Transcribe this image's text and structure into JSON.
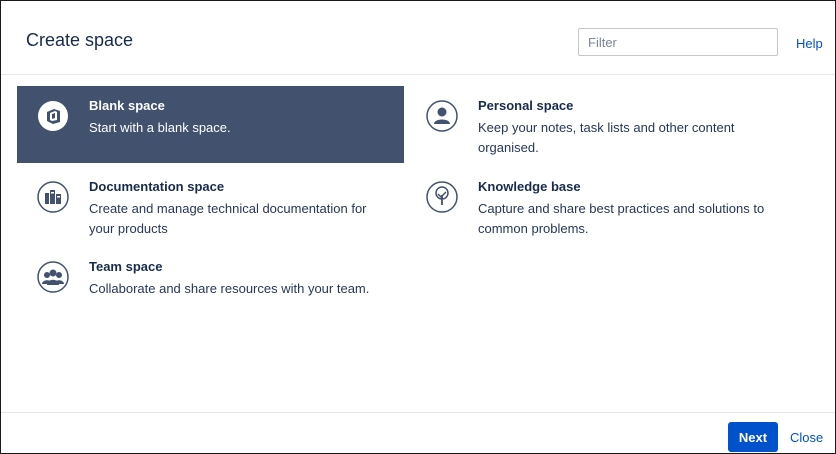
{
  "dialog": {
    "title": "Create space",
    "filter_placeholder": "Filter",
    "help_label": "Help"
  },
  "templates": [
    {
      "name": "Blank space",
      "description": "Start with a blank space.",
      "icon": "blank-space-icon",
      "selected": true
    },
    {
      "name": "Personal space",
      "description": "Keep your notes, task lists and other content organised.",
      "icon": "personal-space-icon",
      "selected": false
    },
    {
      "name": "Documentation space",
      "description": "Create and manage technical documentation for your products",
      "icon": "documentation-space-icon",
      "selected": false
    },
    {
      "name": "Knowledge base",
      "description": "Capture and share best practices and solutions to common problems.",
      "icon": "knowledge-base-icon",
      "selected": false
    },
    {
      "name": "Team space",
      "description": "Collaborate and share resources with your team.",
      "icon": "team-space-icon",
      "selected": false
    }
  ],
  "footer": {
    "next_label": "Next",
    "close_label": "Close"
  },
  "colors": {
    "selected_bg": "#42526e",
    "link": "#0052cc",
    "primary_button": "#0052cc"
  }
}
